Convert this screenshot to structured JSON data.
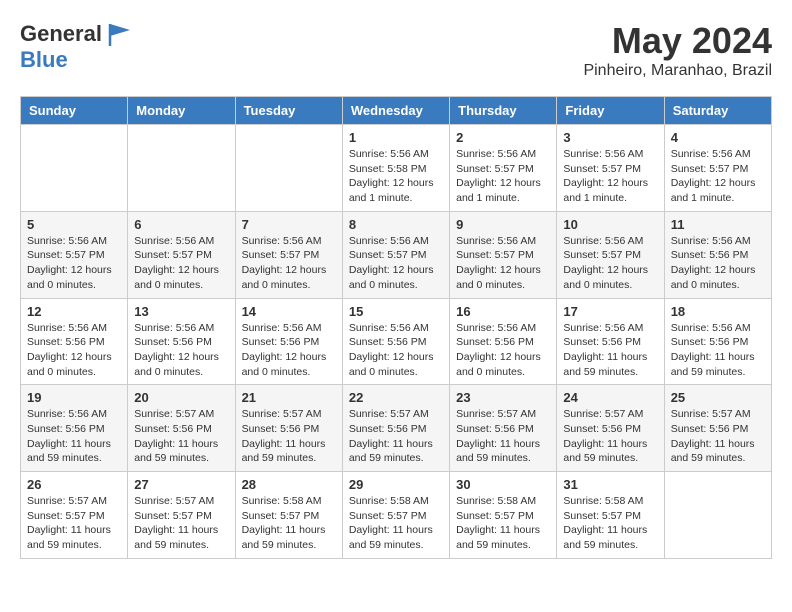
{
  "header": {
    "logo_general": "General",
    "logo_blue": "Blue",
    "month_title": "May 2024",
    "location": "Pinheiro, Maranhao, Brazil"
  },
  "weekdays": [
    "Sunday",
    "Monday",
    "Tuesday",
    "Wednesday",
    "Thursday",
    "Friday",
    "Saturday"
  ],
  "weeks": [
    [
      {
        "day": "",
        "info": ""
      },
      {
        "day": "",
        "info": ""
      },
      {
        "day": "",
        "info": ""
      },
      {
        "day": "1",
        "info": "Sunrise: 5:56 AM\nSunset: 5:58 PM\nDaylight: 12 hours\nand 1 minute."
      },
      {
        "day": "2",
        "info": "Sunrise: 5:56 AM\nSunset: 5:57 PM\nDaylight: 12 hours\nand 1 minute."
      },
      {
        "day": "3",
        "info": "Sunrise: 5:56 AM\nSunset: 5:57 PM\nDaylight: 12 hours\nand 1 minute."
      },
      {
        "day": "4",
        "info": "Sunrise: 5:56 AM\nSunset: 5:57 PM\nDaylight: 12 hours\nand 1 minute."
      }
    ],
    [
      {
        "day": "5",
        "info": "Sunrise: 5:56 AM\nSunset: 5:57 PM\nDaylight: 12 hours\nand 0 minutes."
      },
      {
        "day": "6",
        "info": "Sunrise: 5:56 AM\nSunset: 5:57 PM\nDaylight: 12 hours\nand 0 minutes."
      },
      {
        "day": "7",
        "info": "Sunrise: 5:56 AM\nSunset: 5:57 PM\nDaylight: 12 hours\nand 0 minutes."
      },
      {
        "day": "8",
        "info": "Sunrise: 5:56 AM\nSunset: 5:57 PM\nDaylight: 12 hours\nand 0 minutes."
      },
      {
        "day": "9",
        "info": "Sunrise: 5:56 AM\nSunset: 5:57 PM\nDaylight: 12 hours\nand 0 minutes."
      },
      {
        "day": "10",
        "info": "Sunrise: 5:56 AM\nSunset: 5:57 PM\nDaylight: 12 hours\nand 0 minutes."
      },
      {
        "day": "11",
        "info": "Sunrise: 5:56 AM\nSunset: 5:56 PM\nDaylight: 12 hours\nand 0 minutes."
      }
    ],
    [
      {
        "day": "12",
        "info": "Sunrise: 5:56 AM\nSunset: 5:56 PM\nDaylight: 12 hours\nand 0 minutes."
      },
      {
        "day": "13",
        "info": "Sunrise: 5:56 AM\nSunset: 5:56 PM\nDaylight: 12 hours\nand 0 minutes."
      },
      {
        "day": "14",
        "info": "Sunrise: 5:56 AM\nSunset: 5:56 PM\nDaylight: 12 hours\nand 0 minutes."
      },
      {
        "day": "15",
        "info": "Sunrise: 5:56 AM\nSunset: 5:56 PM\nDaylight: 12 hours\nand 0 minutes."
      },
      {
        "day": "16",
        "info": "Sunrise: 5:56 AM\nSunset: 5:56 PM\nDaylight: 12 hours\nand 0 minutes."
      },
      {
        "day": "17",
        "info": "Sunrise: 5:56 AM\nSunset: 5:56 PM\nDaylight: 11 hours\nand 59 minutes."
      },
      {
        "day": "18",
        "info": "Sunrise: 5:56 AM\nSunset: 5:56 PM\nDaylight: 11 hours\nand 59 minutes."
      }
    ],
    [
      {
        "day": "19",
        "info": "Sunrise: 5:56 AM\nSunset: 5:56 PM\nDaylight: 11 hours\nand 59 minutes."
      },
      {
        "day": "20",
        "info": "Sunrise: 5:57 AM\nSunset: 5:56 PM\nDaylight: 11 hours\nand 59 minutes."
      },
      {
        "day": "21",
        "info": "Sunrise: 5:57 AM\nSunset: 5:56 PM\nDaylight: 11 hours\nand 59 minutes."
      },
      {
        "day": "22",
        "info": "Sunrise: 5:57 AM\nSunset: 5:56 PM\nDaylight: 11 hours\nand 59 minutes."
      },
      {
        "day": "23",
        "info": "Sunrise: 5:57 AM\nSunset: 5:56 PM\nDaylight: 11 hours\nand 59 minutes."
      },
      {
        "day": "24",
        "info": "Sunrise: 5:57 AM\nSunset: 5:56 PM\nDaylight: 11 hours\nand 59 minutes."
      },
      {
        "day": "25",
        "info": "Sunrise: 5:57 AM\nSunset: 5:56 PM\nDaylight: 11 hours\nand 59 minutes."
      }
    ],
    [
      {
        "day": "26",
        "info": "Sunrise: 5:57 AM\nSunset: 5:57 PM\nDaylight: 11 hours\nand 59 minutes."
      },
      {
        "day": "27",
        "info": "Sunrise: 5:57 AM\nSunset: 5:57 PM\nDaylight: 11 hours\nand 59 minutes."
      },
      {
        "day": "28",
        "info": "Sunrise: 5:58 AM\nSunset: 5:57 PM\nDaylight: 11 hours\nand 59 minutes."
      },
      {
        "day": "29",
        "info": "Sunrise: 5:58 AM\nSunset: 5:57 PM\nDaylight: 11 hours\nand 59 minutes."
      },
      {
        "day": "30",
        "info": "Sunrise: 5:58 AM\nSunset: 5:57 PM\nDaylight: 11 hours\nand 59 minutes."
      },
      {
        "day": "31",
        "info": "Sunrise: 5:58 AM\nSunset: 5:57 PM\nDaylight: 11 hours\nand 59 minutes."
      },
      {
        "day": "",
        "info": ""
      }
    ]
  ]
}
